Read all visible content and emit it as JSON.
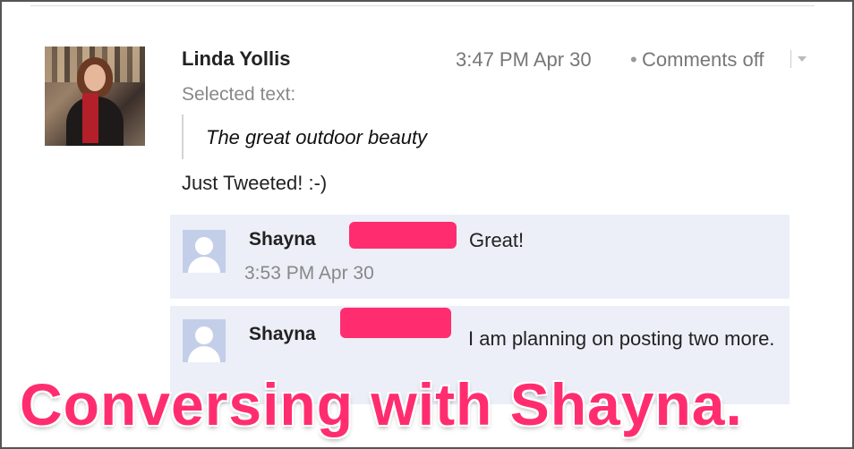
{
  "comment": {
    "author": "Linda Yollis",
    "time": "3:47 PM Apr 30",
    "separator": "•",
    "status": "Comments off",
    "selected_label": "Selected text:",
    "quote": "The great outdoor beauty",
    "text": "Just Tweeted! :-)"
  },
  "replies": [
    {
      "name": "Shayna",
      "body": "Great!",
      "time": "3:53 PM Apr 30"
    },
    {
      "name": "Shayna",
      "body": "I am planning on posting two more."
    }
  ],
  "caption": "Conversing with Shayna.",
  "colors": {
    "highlight": "#ff2d6f",
    "reply_bg": "#eceff7"
  },
  "icons": {
    "menu": "chevron-down-icon",
    "default_avatar": "person-icon"
  }
}
